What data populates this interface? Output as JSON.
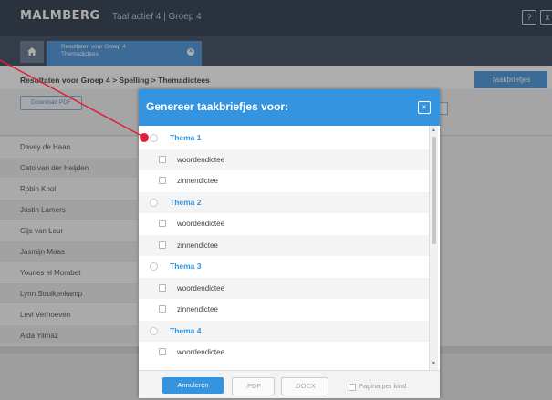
{
  "header": {
    "logo": "MALMBERG",
    "app_title": "Taal actief 4  |  Groep 4",
    "help_label": "?",
    "close_label": "x"
  },
  "tabs": {
    "home_icon": "home-icon",
    "tab_line1": "Resultaten voor Groep 4",
    "tab_line2": "Themadictees",
    "tab_close": "×"
  },
  "page": {
    "breadcrumb": "Resultaten voor Groep 4 > Spelling > Themadictees",
    "taakbriefjes_label": "Taakbriefjes",
    "download_pdf_label": "Download PDF",
    "students": [
      "Davey de Haan",
      "Cato van der Heijden",
      "Robin Knol",
      "Justin Lamers",
      "Gijs van Leur",
      "Jasmijn Maas",
      "Younes el Morabet",
      "Lynn Struikenkamp",
      "Levi Verhoeven",
      "Aida Yilmaz"
    ]
  },
  "modal": {
    "title": "Genereer taakbriefjes voor:",
    "close_label": "×",
    "themes": [
      {
        "name": "Thema 1",
        "items": [
          "woordendictee",
          "zinnendictee"
        ]
      },
      {
        "name": "Thema 2",
        "items": [
          "woordendictee",
          "zinnendictee"
        ]
      },
      {
        "name": "Thema 3",
        "items": [
          "woordendictee",
          "zinnendictee"
        ]
      },
      {
        "name": "Thema 4",
        "items": [
          "woordendictee"
        ]
      }
    ],
    "footer": {
      "cancel_label": "Annuleren",
      "pdf_label": ".PDF",
      "docx_label": ".DOCX",
      "per_child_label": "Pagina per kind"
    }
  },
  "colors": {
    "accent": "#3594df",
    "topbar": "#1c2b3e",
    "annotation": "#e0203a"
  }
}
